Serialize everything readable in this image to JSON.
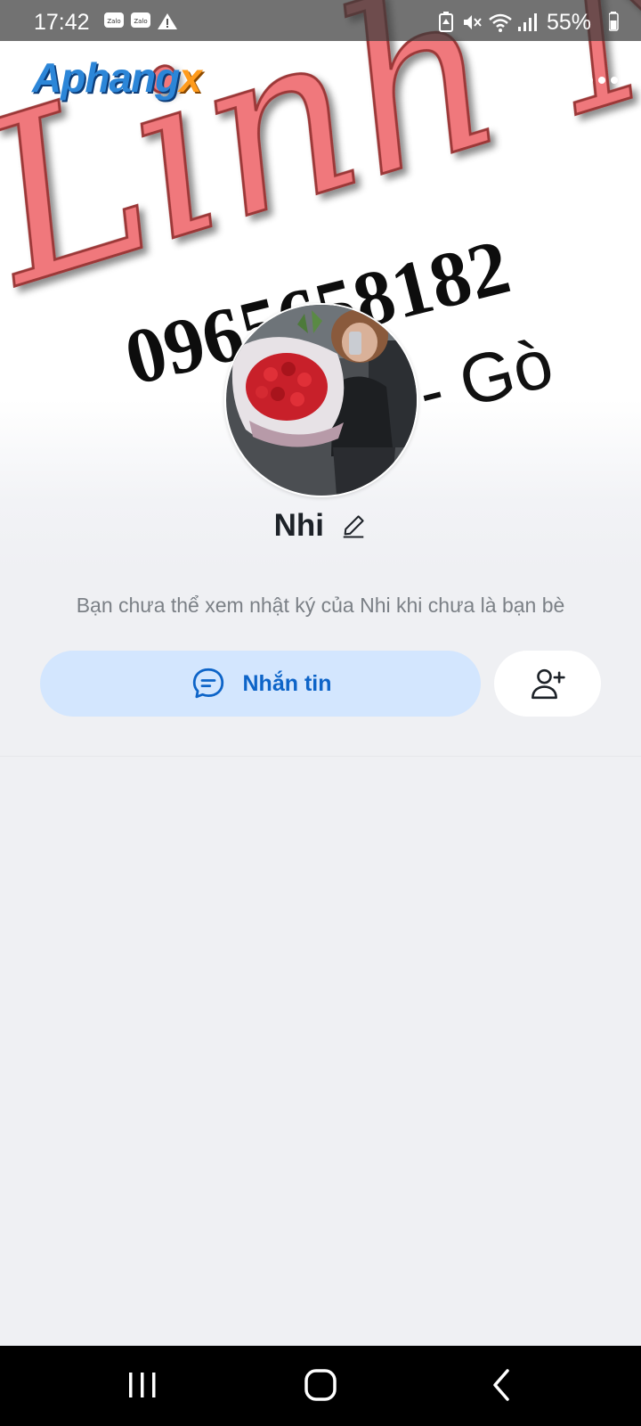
{
  "status_bar": {
    "time": "17:42",
    "notif_1": "Zalo",
    "notif_2": "Zalo",
    "battery": "55%"
  },
  "cover": {
    "logo_main": "Aphang",
    "logo_x": "x",
    "script_text": "Linh Nh",
    "phone_text": "0965658182",
    "side_text": "- Gò"
  },
  "profile": {
    "name": "Nhi",
    "info_text": "Bạn chưa thể xem nhật ký của Nhi khi chưa là bạn bè"
  },
  "actions": {
    "message_label": "Nhắn tin"
  },
  "colors": {
    "accent": "#0d64c8",
    "message_button_bg": "#d3e6fe",
    "page_bg": "#eff0f3"
  },
  "icons": [
    "back-icon",
    "phone-icon",
    "more-icon",
    "edit-icon",
    "chat-icon",
    "add-friend-icon",
    "recents-icon",
    "home-icon",
    "nav-back-icon"
  ]
}
